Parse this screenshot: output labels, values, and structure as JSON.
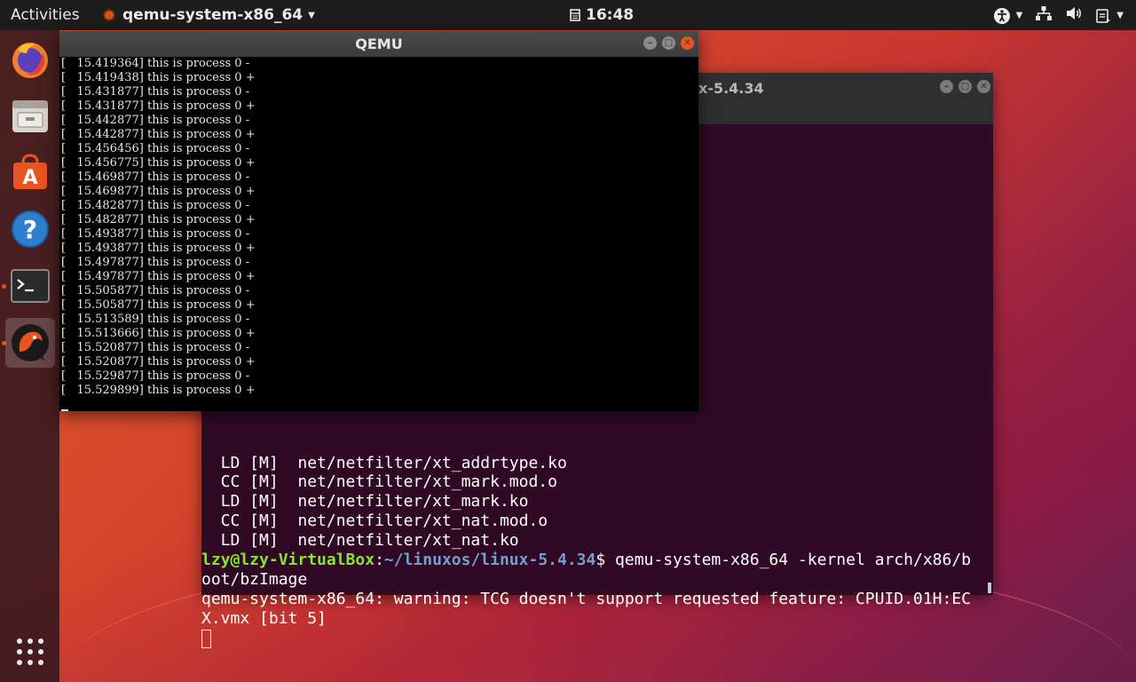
{
  "topbar": {
    "activities": "Activities",
    "app_name": "qemu-system-x86_64",
    "clock": "16:48"
  },
  "dock": {
    "apps": [
      "firefox",
      "files",
      "software",
      "help",
      "terminal",
      "qemu"
    ],
    "show_apps_icon": "grid-icon"
  },
  "terminal": {
    "title_partial": "x-5.4.34",
    "hidden_line": "  LD [M]  net/netfilter/xt_addrtype.ko",
    "lines": [
      "  CC [M]  net/netfilter/xt_mark.mod.o",
      "  LD [M]  net/netfilter/xt_mark.ko",
      "  CC [M]  net/netfilter/xt_nat.mod.o",
      "  LD [M]  net/netfilter/xt_nat.ko"
    ],
    "prompt_user": "lzy@lzy-VirtualBox",
    "prompt_sep": ":",
    "prompt_path": "~/linuxos/linux-5.4.34",
    "prompt_dollar": "$ ",
    "command_line1": "qemu-system-x86_64 -kernel arch/x86/b",
    "command_line2": "oot/bzImage",
    "warning_line1": "qemu-system-x86_64: warning: TCG doesn't support requested feature: CPUID.01H:EC",
    "warning_line2": "X.vmx [bit 5]"
  },
  "qemu": {
    "title": "QEMU",
    "lines": [
      "[   15.419364] this is process 0 -",
      "[   15.419438] this is process 0 +",
      "[   15.431877] this is process 0 -",
      "[   15.431877] this is process 0 +",
      "[   15.442877] this is process 0 -",
      "[   15.442877] this is process 0 +",
      "[   15.456456] this is process 0 -",
      "[   15.456775] this is process 0 +",
      "[   15.469877] this is process 0 -",
      "[   15.469877] this is process 0 +",
      "[   15.482877] this is process 0 -",
      "[   15.482877] this is process 0 +",
      "[   15.493877] this is process 0 -",
      "[   15.493877] this is process 0 +",
      "[   15.497877] this is process 0 -",
      "[   15.497877] this is process 0 +",
      "[   15.505877] this is process 0 -",
      "[   15.505877] this is process 0 +",
      "[   15.513589] this is process 0 -",
      "[   15.513666] this is process 0 +",
      "[   15.520877] this is process 0 -",
      "[   15.520877] this is process 0 +",
      "[   15.529877] this is process 0 -",
      "[   15.529899] this is process 0 +"
    ]
  }
}
